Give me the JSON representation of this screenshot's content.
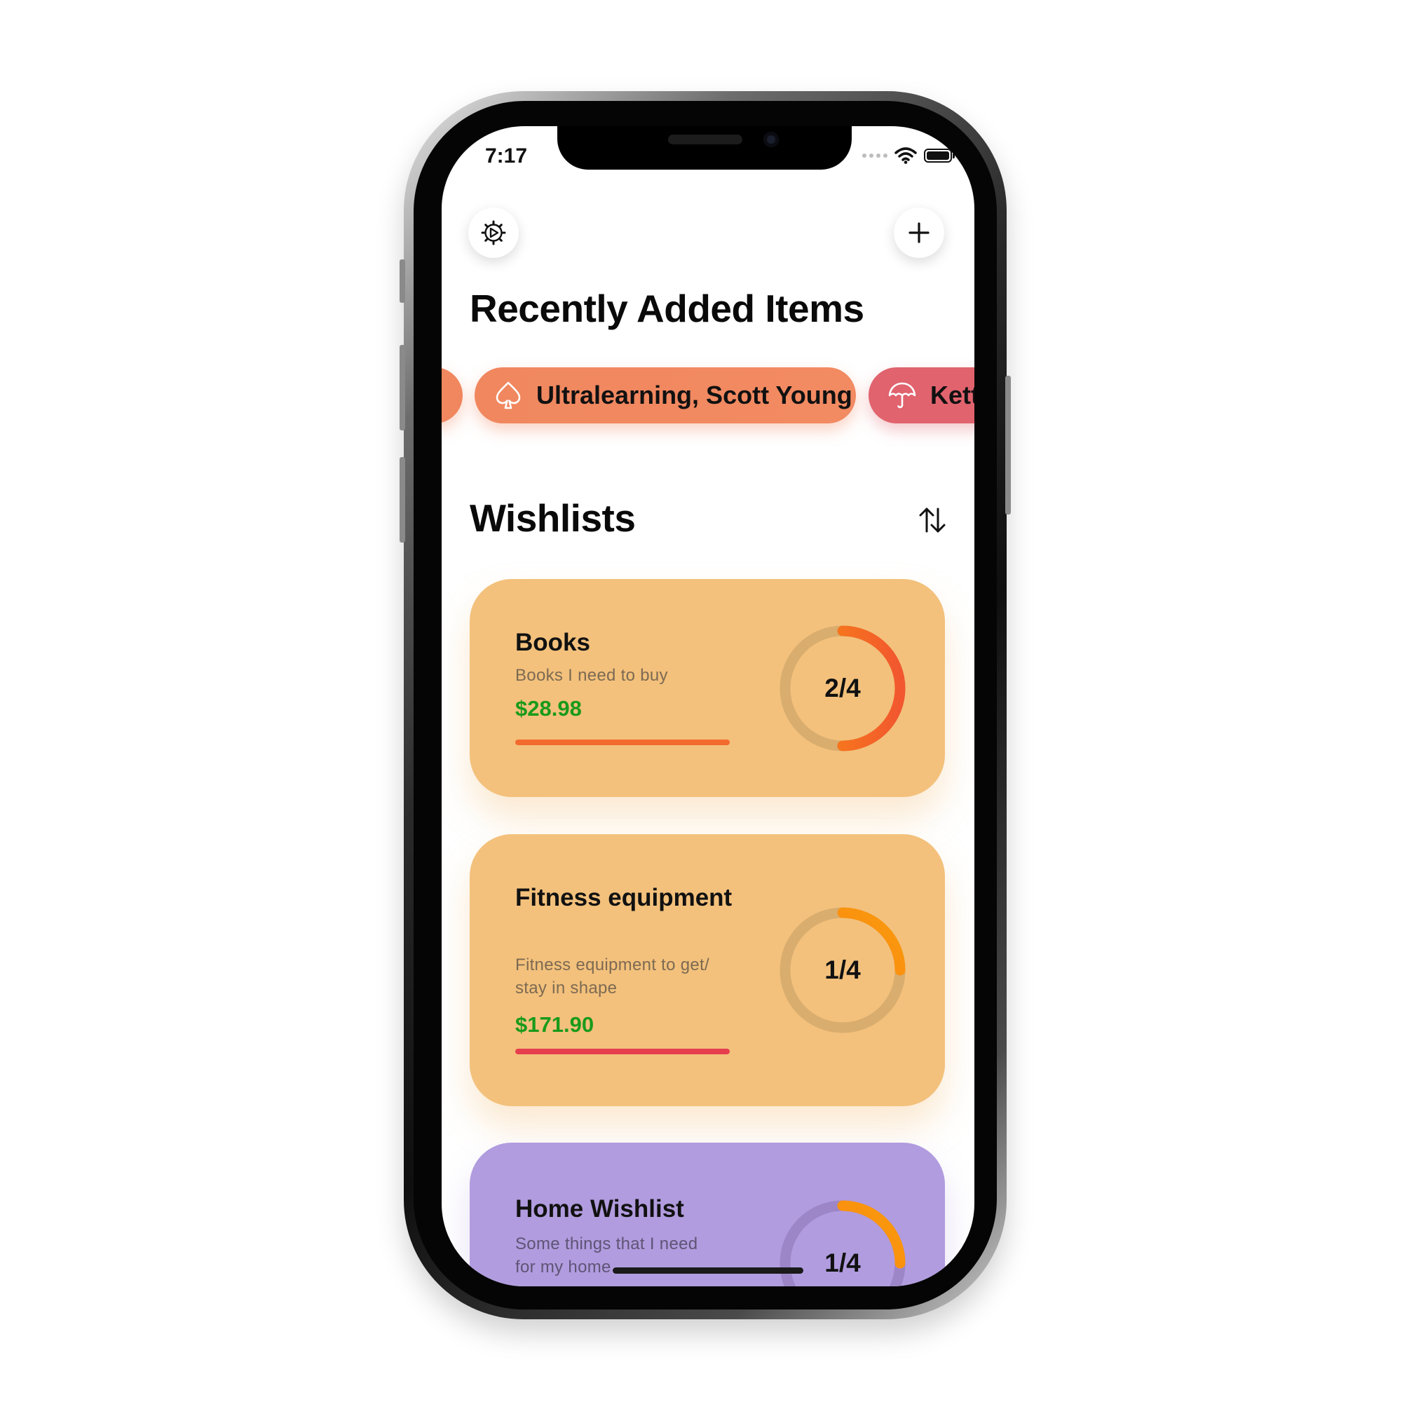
{
  "status_bar": {
    "time": "7:17"
  },
  "header": {
    "settings_icon": "gear-icon",
    "add_icon": "plus-icon",
    "title": "Recently Added Items"
  },
  "recent_items": [
    {
      "label": "Ultralearning, Scott Young",
      "icon": "spade-icon",
      "color": "#F0875F"
    },
    {
      "label": "Kett",
      "icon": "umbrella-icon",
      "color": "#E0636E"
    }
  ],
  "wishlists": {
    "title": "Wishlists",
    "sort_icon": "sort-arrows-icon",
    "cards": [
      {
        "title": "Books",
        "description": "Books I need to buy",
        "price": "$28.98",
        "progress_text": "2/4",
        "progress": 0.5,
        "color": "#F3C17C",
        "bar_color": "#F26A2E"
      },
      {
        "title": "Fitness equipment",
        "description": "Fitness equipment to get/ stay in shape",
        "price": "$171.90",
        "progress_text": "1/4",
        "progress": 0.25,
        "color": "#F3C17C",
        "bar_color": "#E73E4E"
      },
      {
        "title": "Home Wishlist",
        "description": "Some things that I need for my home",
        "progress_text": "1/4",
        "progress": 0.25,
        "color": "#B19CDF"
      }
    ]
  }
}
